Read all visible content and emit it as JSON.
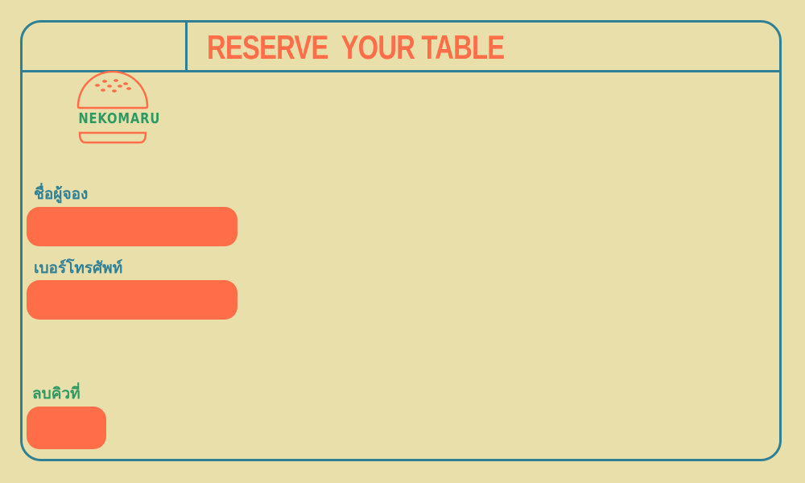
{
  "header": {
    "title": "RESERVE  YOUR TABLE"
  },
  "logo": {
    "icon": "burger-icon",
    "text": "NEKOMARU"
  },
  "form": {
    "name_label": "ชื่อผู้จอง",
    "name_value": "",
    "phone_label": "เบอร์โทรศัพท์",
    "phone_value": "",
    "delete_label": "ลบคิวที่",
    "delete_value": ""
  },
  "colors": {
    "background": "#e8dfab",
    "border": "#2f7f95",
    "accent": "#ff6e48",
    "green": "#2e9a63"
  }
}
